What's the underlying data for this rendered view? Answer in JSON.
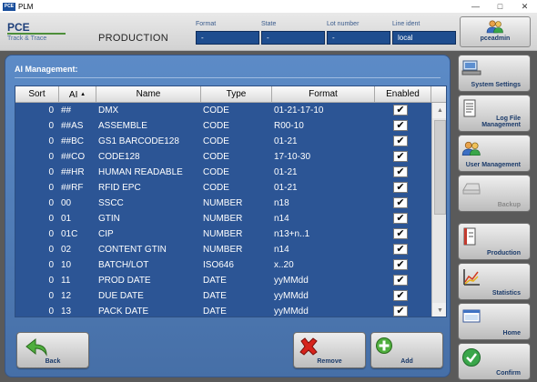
{
  "window": {
    "title": "PLM",
    "icon_text": "PCE",
    "minimize": "—",
    "maximize": "□",
    "close": "✕"
  },
  "header": {
    "logo_main": "PCE",
    "logo_sub": "Track & Trace",
    "page_name": "PRODUCTION",
    "fields": [
      {
        "label": "Format",
        "value": "-"
      },
      {
        "label": "State",
        "value": "-"
      },
      {
        "label": "Lot number",
        "value": "-"
      },
      {
        "label": "Line ident",
        "value": "local"
      }
    ],
    "user": {
      "name": "pceadmin",
      "icon": "users-icon"
    }
  },
  "panel": {
    "title": "AI Management:",
    "columns": {
      "sort": "Sort",
      "ai": "AI",
      "name": "Name",
      "type": "Type",
      "format": "Format",
      "enabled": "Enabled"
    },
    "ai_sort_indicator": "▲",
    "check_mark": "✔",
    "rows": [
      {
        "sort": "0",
        "ai": "##",
        "name": "DMX",
        "type": "CODE",
        "format": "01-21-17-10",
        "enabled": true
      },
      {
        "sort": "0",
        "ai": "##AS",
        "name": "ASSEMBLE",
        "type": "CODE",
        "format": "R00-10",
        "enabled": true
      },
      {
        "sort": "0",
        "ai": "##BC",
        "name": "GS1 BARCODE128",
        "type": "CODE",
        "format": "01-21",
        "enabled": true
      },
      {
        "sort": "0",
        "ai": "##CO",
        "name": "CODE128",
        "type": "CODE",
        "format": "17-10-30",
        "enabled": true
      },
      {
        "sort": "0",
        "ai": "##HR",
        "name": "HUMAN READABLE",
        "type": "CODE",
        "format": "01-21",
        "enabled": true
      },
      {
        "sort": "0",
        "ai": "##RF",
        "name": "RFID EPC",
        "type": "CODE",
        "format": "01-21",
        "enabled": true
      },
      {
        "sort": "0",
        "ai": "00",
        "name": "SSCC",
        "type": "NUMBER",
        "format": "n18",
        "enabled": true
      },
      {
        "sort": "0",
        "ai": "01",
        "name": "GTIN",
        "type": "NUMBER",
        "format": "n14",
        "enabled": true
      },
      {
        "sort": "0",
        "ai": "01C",
        "name": "CIP",
        "type": "NUMBER",
        "format": "n13+n..1",
        "enabled": true
      },
      {
        "sort": "0",
        "ai": "02",
        "name": "CONTENT GTIN",
        "type": "NUMBER",
        "format": "n14",
        "enabled": true
      },
      {
        "sort": "0",
        "ai": "10",
        "name": "BATCH/LOT",
        "type": "ISO646",
        "format": "x..20",
        "enabled": true
      },
      {
        "sort": "0",
        "ai": "11",
        "name": "PROD DATE",
        "type": "DATE",
        "format": "yyMMdd",
        "enabled": true
      },
      {
        "sort": "0",
        "ai": "12",
        "name": "DUE DATE",
        "type": "DATE",
        "format": "yyMMdd",
        "enabled": true
      },
      {
        "sort": "0",
        "ai": "13",
        "name": "PACK DATE",
        "type": "DATE",
        "format": "yyMMdd",
        "enabled": true
      }
    ],
    "scroll": {
      "up": "▲",
      "down": "▼"
    },
    "buttons": {
      "back": "Back",
      "remove": "Remove",
      "add": "Add"
    }
  },
  "sidebar": {
    "items": [
      {
        "label": "System Settings",
        "icon": "computer-icon",
        "disabled": false
      },
      {
        "label": "Log File Management",
        "icon": "document-icon",
        "disabled": false
      },
      {
        "label": "User Management",
        "icon": "users-icon",
        "disabled": false
      },
      {
        "label": "Backup",
        "icon": "backup-icon",
        "disabled": true
      },
      {
        "label": "Production",
        "icon": "production-icon",
        "disabled": false
      },
      {
        "label": "Statistics",
        "icon": "chart-icon",
        "disabled": false
      },
      {
        "label": "Home",
        "icon": "home-icon",
        "disabled": false
      },
      {
        "label": "Confirm",
        "icon": "checkmark-icon",
        "disabled": false
      }
    ]
  },
  "colors": {
    "panel": "#5a88c4",
    "grid_rows": "#2c5595",
    "field_box": "#1e4d8f",
    "label_text": "#1a3a6a"
  }
}
